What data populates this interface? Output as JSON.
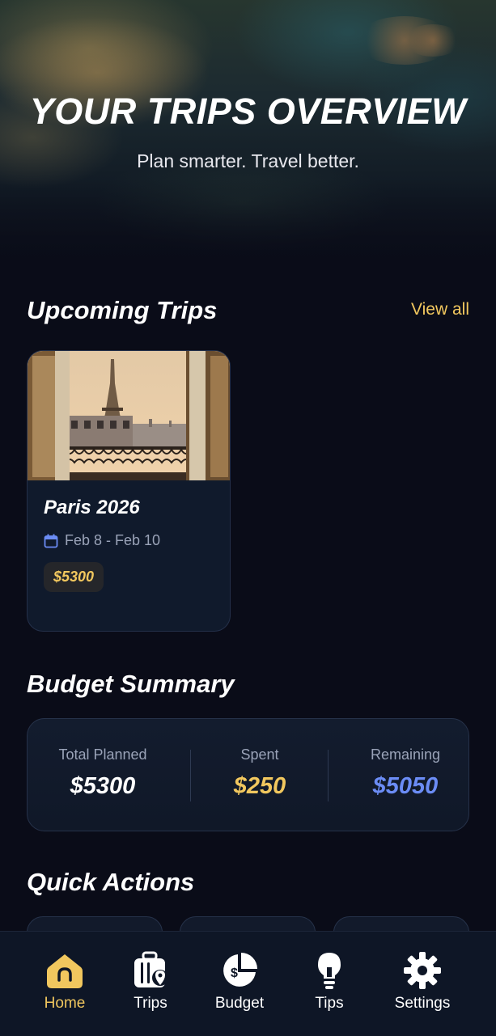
{
  "hero": {
    "title": "YOUR TRIPS OVERVIEW",
    "subtitle": "Plan smarter. Travel better."
  },
  "upcoming": {
    "title": "Upcoming Trips",
    "view_all": "View all",
    "trips": [
      {
        "name": "Paris 2026",
        "dates": "Feb 8 - Feb 10",
        "price": "$5300",
        "date_icon": "calendar-icon"
      }
    ]
  },
  "budget": {
    "title": "Budget Summary",
    "total_label": "Total Planned",
    "total_value": "$5300",
    "spent_label": "Spent",
    "spent_value": "$250",
    "remaining_label": "Remaining",
    "remaining_value": "$5050"
  },
  "quick_actions": {
    "title": "Quick Actions"
  },
  "nav": {
    "items": [
      {
        "label": "Home",
        "icon": "home-icon",
        "active": true
      },
      {
        "label": "Trips",
        "icon": "luggage-icon",
        "active": false
      },
      {
        "label": "Budget",
        "icon": "budget-pie-icon",
        "active": false
      },
      {
        "label": "Tips",
        "icon": "lightbulb-icon",
        "active": false
      },
      {
        "label": "Settings",
        "icon": "gear-icon",
        "active": false
      }
    ]
  },
  "colors": {
    "background": "#0a0c18",
    "accent_gold": "#f1c75e",
    "accent_blue": "#6b8cf5",
    "card": "#101a2c",
    "muted_text": "#9aa3b8"
  }
}
